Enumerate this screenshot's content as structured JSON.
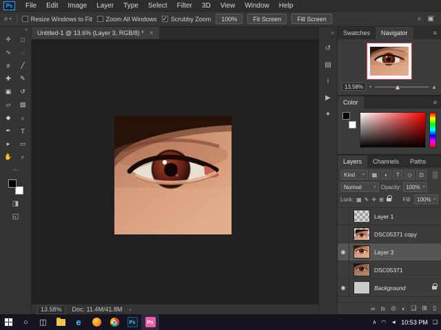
{
  "colors": {
    "accent_blue": "#31a8ff",
    "taskbar_active_pink": "#ee5fa4",
    "navigator_view_box_red": "#e03a3a"
  },
  "menubar": {
    "logo": "Ps",
    "items": [
      "File",
      "Edit",
      "Image",
      "Layer",
      "Type",
      "Select",
      "Filter",
      "3D",
      "View",
      "Window",
      "Help"
    ]
  },
  "optionsbar": {
    "tool_icon": "⌕",
    "tool_caret": "▾",
    "checkboxes": [
      {
        "label": "Resize Windows to Fit",
        "mark": ""
      },
      {
        "label": "Zoom All Windows",
        "mark": ""
      },
      {
        "label": "Scrubby Zoom",
        "mark": "✓"
      }
    ],
    "zoom_value": "100%",
    "buttons": [
      {
        "label": "Fit Screen"
      },
      {
        "label": "Fill Screen"
      }
    ],
    "right_icons": [
      {
        "name": "search-icon",
        "glyph": "⌕"
      },
      {
        "name": "workspace-icon",
        "glyph": "▣"
      }
    ]
  },
  "document": {
    "tab_title": "Untitled-1 @ 13.6% (Layer 3, RGB/8) *",
    "close_glyph": "×"
  },
  "toolbar": {
    "collapse_glyph": "»",
    "tools": [
      {
        "name": "move-tool",
        "glyph": "✛"
      },
      {
        "name": "marquee-tool",
        "glyph": "□"
      },
      {
        "name": "lasso-tool",
        "glyph": "∿"
      },
      {
        "name": "quick-selection-tool",
        "glyph": "◌"
      },
      {
        "name": "crop-tool",
        "glyph": "#"
      },
      {
        "name": "eyedropper-tool",
        "glyph": "╱"
      },
      {
        "name": "healing-brush-tool",
        "glyph": "✚"
      },
      {
        "name": "brush-tool",
        "glyph": "✎"
      },
      {
        "name": "clone-stamp-tool",
        "glyph": "▣"
      },
      {
        "name": "history-brush-tool",
        "glyph": "↺"
      },
      {
        "name": "eraser-tool",
        "glyph": "▱"
      },
      {
        "name": "gradient-tool",
        "glyph": "▧"
      },
      {
        "name": "blur-tool",
        "glyph": "◆"
      },
      {
        "name": "dodge-tool",
        "glyph": "○"
      },
      {
        "name": "pen-tool",
        "glyph": "✒"
      },
      {
        "name": "type-tool",
        "glyph": "T"
      },
      {
        "name": "path-selection-tool",
        "glyph": "▸"
      },
      {
        "name": "rectangle-tool",
        "glyph": "▭"
      },
      {
        "name": "hand-tool",
        "glyph": "✋"
      },
      {
        "name": "zoom-tool",
        "glyph": "⌕"
      }
    ],
    "edit_toolbar_glyph": "⋯",
    "quick_mask_glyph": "◨",
    "screen_mode_glyph": "◱"
  },
  "statusbar": {
    "zoom": "13.58%",
    "doc_info": "Doc: 11.4M/41.8M",
    "chevron": "›"
  },
  "side_strip": [
    {
      "name": "expand-panels",
      "glyph": "«"
    },
    {
      "name": "history-panel",
      "glyph": "↺"
    },
    {
      "name": "properties-panel",
      "glyph": "▤"
    },
    {
      "name": "info-panel",
      "glyph": "i"
    },
    {
      "name": "actions-panel",
      "glyph": "▶"
    },
    {
      "name": "brush-settings-panel",
      "glyph": "✦"
    }
  ],
  "navigator": {
    "tabs": [
      "Swatches",
      "Navigator"
    ],
    "menu_glyph": "≡",
    "zoom": "13.58%",
    "zoom_out_glyph": "▲",
    "zoom_in_glyph": "▲"
  },
  "color_panel": {
    "title": "Color",
    "menu_glyph": "≡"
  },
  "layers_panel": {
    "tabs": [
      "Layers",
      "Channels",
      "Paths"
    ],
    "kind_label": "Kind",
    "caret": "▾",
    "filter_icons": [
      {
        "name": "filter-pixel-layers",
        "glyph": "▦"
      },
      {
        "name": "filter-adjustment-layers",
        "glyph": "◐"
      },
      {
        "name": "filter-type-layers",
        "glyph": "T"
      },
      {
        "name": "filter-shape-layers",
        "glyph": "◇"
      },
      {
        "name": "filter-smart-objects",
        "glyph": "⊡"
      }
    ],
    "blend_mode": "Normal",
    "opacity_label": "Opacity:",
    "opacity_value": "100%",
    "lock_label": "Lock:",
    "lock_icons": [
      {
        "name": "lock-transparent-pixels",
        "glyph": "▦"
      },
      {
        "name": "lock-image-pixels",
        "glyph": "✎"
      },
      {
        "name": "lock-position",
        "glyph": "✛"
      },
      {
        "name": "lock-artboards",
        "glyph": "⊞"
      }
    ],
    "fill_label": "Fill:",
    "fill_value": "100%",
    "rows": [
      {
        "name": "Layer 1",
        "eye": ""
      },
      {
        "name": "DSC05371 copy",
        "eye": ""
      },
      {
        "name": "Layer 3",
        "eye": "◉"
      },
      {
        "name": "DSC05371",
        "eye": ""
      },
      {
        "name": "Background",
        "eye": "◉"
      }
    ],
    "footer_icons": [
      {
        "name": "link-layers",
        "glyph": "∞"
      },
      {
        "name": "layer-styles",
        "glyph": "fx"
      },
      {
        "name": "add-layer-mask",
        "glyph": "◎"
      },
      {
        "name": "new-adjustment-layer",
        "glyph": "◐"
      },
      {
        "name": "new-group",
        "glyph": "❏"
      },
      {
        "name": "new-layer",
        "glyph": "⊞"
      },
      {
        "name": "delete-layer",
        "glyph": "▯"
      }
    ]
  },
  "taskbar": {
    "search_glyph": "○",
    "task_view_glyph": "◫",
    "ps_label": "Ps",
    "edge_label": "e",
    "tray_icons": [
      {
        "name": "hidden-icons",
        "glyph": "∧"
      },
      {
        "name": "network",
        "glyph": "◠"
      },
      {
        "name": "volume",
        "glyph": "◄"
      }
    ],
    "time": "10:53 PM",
    "notification_glyph": "❑"
  }
}
